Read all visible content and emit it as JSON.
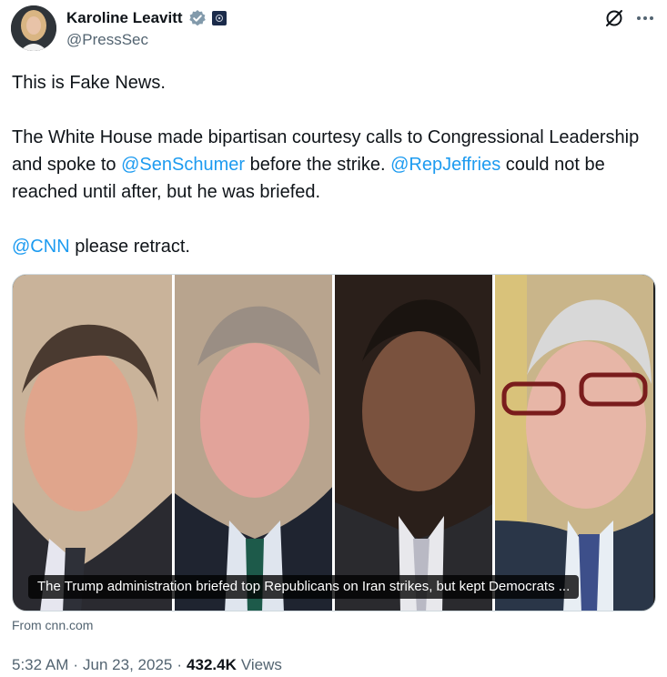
{
  "author": {
    "display_name": "Karoline Leavitt",
    "handle": "@PressSec"
  },
  "tweet": {
    "paragraphs": [
      [
        {
          "text": "This is Fake News."
        }
      ],
      [
        {
          "text": "The White House made bipartisan courtesy calls to Congressional Leadership and spoke to "
        },
        {
          "text": "@SenSchumer",
          "mention": true
        },
        {
          "text": " before the strike. "
        },
        {
          "text": "@RepJeffries",
          "mention": true
        },
        {
          "text": " could not be reached until after, but he was briefed."
        }
      ],
      [
        {
          "text": "@CNN",
          "mention": true
        },
        {
          "text": " please retract."
        }
      ]
    ]
  },
  "media": {
    "caption": "The Trump administration briefed top Republicans on Iran strikes, but kept Democrats ...",
    "source": "From cnn.com",
    "panels": [
      "portrait-1",
      "portrait-2",
      "portrait-3",
      "portrait-4"
    ]
  },
  "meta": {
    "time": "5:32 AM",
    "separator": "·",
    "date": "Jun 23, 2025",
    "views_count": "432.4K",
    "views_label": "Views"
  },
  "icons": {
    "verified": "verified-badge-icon",
    "affiliate": "government-affiliate-icon",
    "grok": "grok-icon",
    "more": "more-options-icon"
  },
  "colors": {
    "mention": "#1d9bf0",
    "secondary_text": "#536471",
    "primary_text": "#0f1419",
    "verified": "#829aab"
  }
}
